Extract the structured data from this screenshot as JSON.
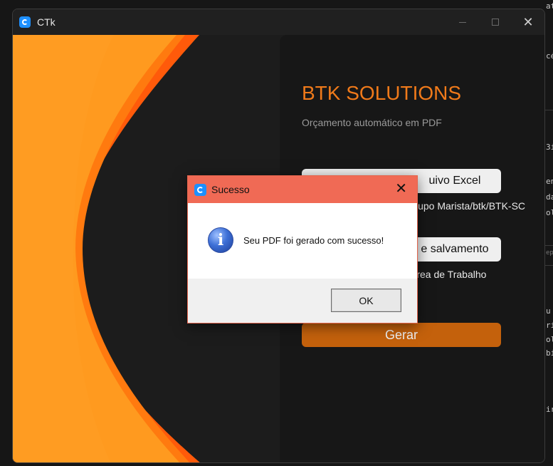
{
  "window": {
    "title": "CTk"
  },
  "app": {
    "brand": "BTK SOLUTIONS",
    "subtitle": "Orçamento automático em PDF",
    "excel_button": "uivo Excel",
    "excel_path": "- Grupo Marista/btk/BTK-SC",
    "save_button": "e salvamento",
    "save_path": "Área de Trabalho",
    "generate_button": "Gerar"
  },
  "dialog": {
    "title": "Sucesso",
    "message": "Seu PDF foi gerado com sucesso!",
    "ok_label": "OK"
  },
  "background_text": [
    "ata",
    "cé",
    "3i",
    "en",
    "da",
    "ol",
    "epi",
    "u",
    "ri",
    "ol",
    "bi",
    "ir"
  ],
  "icons": {
    "app": "ctk-app-icon",
    "minimize": "minimize-icon",
    "maximize": "maximize-icon",
    "close": "close-icon",
    "info": "info-icon"
  },
  "colors": {
    "brand": "#f07a1a",
    "generate_button": "#c4610c",
    "dialog_titlebar": "#f06a55",
    "art_orange_light": "#ff9a1f",
    "art_orange_dark": "#ff5a0a"
  }
}
